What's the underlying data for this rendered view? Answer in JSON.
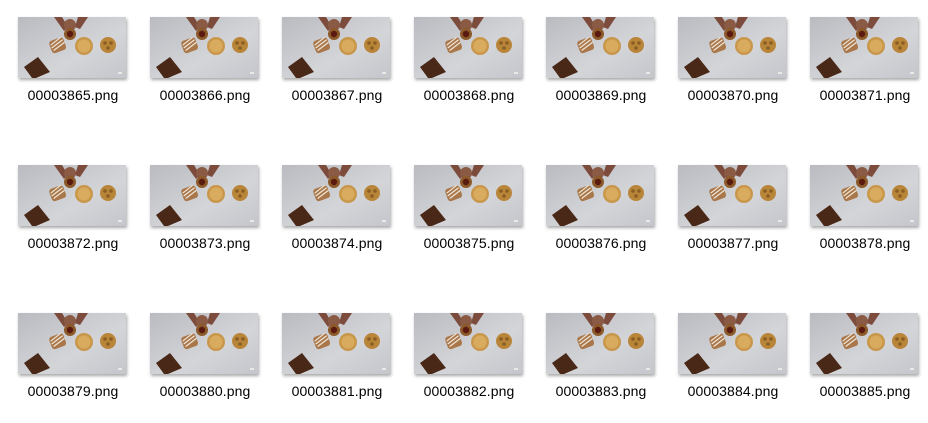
{
  "files": [
    {
      "name": "00003865.png",
      "thumbnail": "cookies-photo"
    },
    {
      "name": "00003866.png",
      "thumbnail": "cookies-photo"
    },
    {
      "name": "00003867.png",
      "thumbnail": "cookies-photo"
    },
    {
      "name": "00003868.png",
      "thumbnail": "cookies-photo"
    },
    {
      "name": "00003869.png",
      "thumbnail": "cookies-photo"
    },
    {
      "name": "00003870.png",
      "thumbnail": "cookies-photo"
    },
    {
      "name": "00003871.png",
      "thumbnail": "cookies-photo"
    },
    {
      "name": "00003872.png",
      "thumbnail": "cookies-photo"
    },
    {
      "name": "00003873.png",
      "thumbnail": "cookies-photo"
    },
    {
      "name": "00003874.png",
      "thumbnail": "cookies-photo"
    },
    {
      "name": "00003875.png",
      "thumbnail": "cookies-photo"
    },
    {
      "name": "00003876.png",
      "thumbnail": "cookies-photo"
    },
    {
      "name": "00003877.png",
      "thumbnail": "cookies-photo"
    },
    {
      "name": "00003878.png",
      "thumbnail": "cookies-photo"
    },
    {
      "name": "00003879.png",
      "thumbnail": "cookies-photo"
    },
    {
      "name": "00003880.png",
      "thumbnail": "cookies-photo"
    },
    {
      "name": "00003881.png",
      "thumbnail": "cookies-photo"
    },
    {
      "name": "00003882.png",
      "thumbnail": "cookies-photo"
    },
    {
      "name": "00003883.png",
      "thumbnail": "cookies-photo"
    },
    {
      "name": "00003884.png",
      "thumbnail": "cookies-photo"
    },
    {
      "name": "00003885.png",
      "thumbnail": "cookies-photo"
    }
  ],
  "colors": {
    "background": "#ffffff",
    "text": "#000000",
    "table_surface": "#c9cbd0",
    "chocolate": "#4a2818",
    "cookie": "#c89a4e",
    "hand": "#7a4a3a"
  }
}
